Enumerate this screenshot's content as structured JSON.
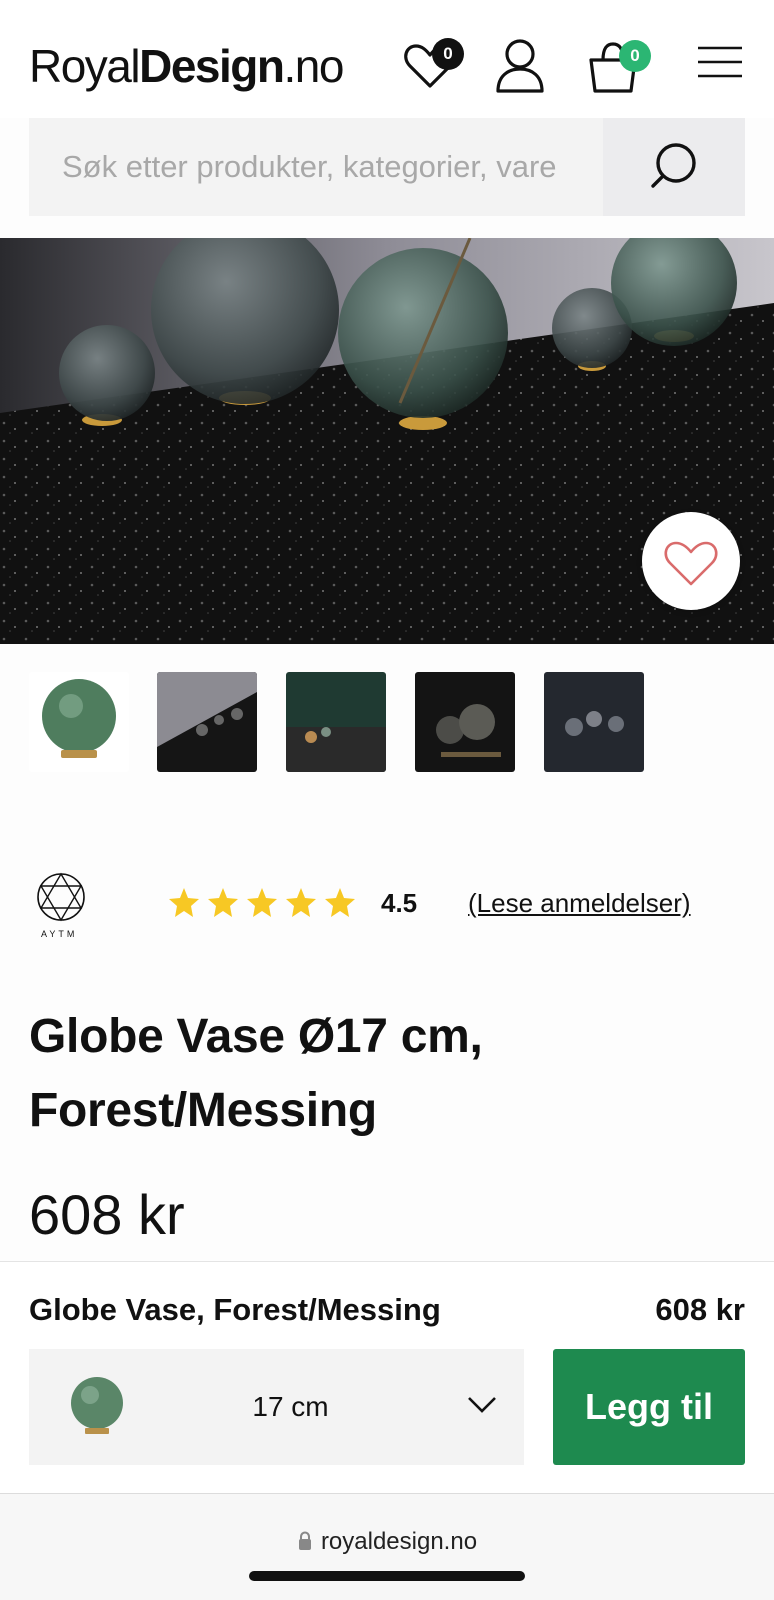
{
  "header": {
    "logo": {
      "part1": "Royal",
      "part2": "Design",
      "part3": ".no"
    },
    "wishlist_count": "0",
    "cart_count": "0",
    "cart_badge_color": "#2bb673",
    "icons": [
      "heart-icon",
      "user-icon",
      "basket-icon",
      "menu-icon"
    ]
  },
  "search": {
    "placeholder": "Søk etter produkter, kategorier, vare",
    "icon": "search-icon"
  },
  "product": {
    "brand": "AYTM",
    "rating": "4.5",
    "rating_stars": 5,
    "reviews_link": "(Lese anmeldelser)",
    "title": "Globe Vase Ø17 cm, Forest/Messing",
    "price": "608 kr"
  },
  "gallery": {
    "thumb_count": 5,
    "favorite_icon": "heart-outline-icon"
  },
  "buy_bar": {
    "name": "Globe Vase, Forest/Messing",
    "price": "608 kr",
    "variant": "17 cm",
    "add_label": "Legg til",
    "accent": "#1e8a4f"
  },
  "browser": {
    "url": "royaldesign.no"
  }
}
